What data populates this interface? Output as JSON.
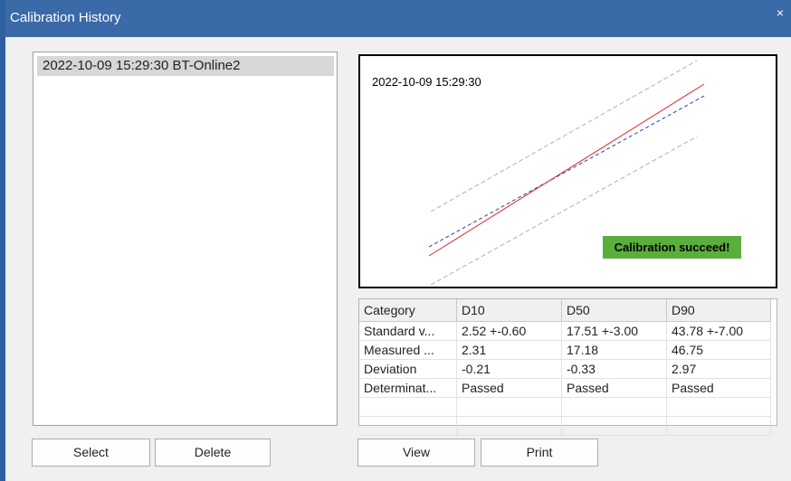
{
  "window": {
    "title": "Calibration History",
    "close_glyph": "×"
  },
  "history_list": {
    "items": [
      "2022-10-09 15:29:30 BT-Online2"
    ]
  },
  "chart": {
    "timestamp": "2022-10-09 15:29:30",
    "status_text": "Calibration succeed!",
    "status_color": "#5aaf3c",
    "measured_line_color": "#e8262b",
    "reference_line_color": "#2243b6",
    "tolerance_line_color": "#b0b0b0"
  },
  "table": {
    "headers": [
      "Category",
      "D10",
      "D50",
      "D90"
    ],
    "rows": [
      [
        "Standard v...",
        "2.52 +-0.60",
        "17.51 +-3.00",
        "43.78 +-7.00"
      ],
      [
        "Measured ...",
        "2.31",
        "17.18",
        "46.75"
      ],
      [
        "Deviation",
        "-0.21",
        "-0.33",
        "2.97"
      ],
      [
        "Determinat...",
        "Passed",
        "Passed",
        "Passed"
      ]
    ]
  },
  "buttons": {
    "select": "Select",
    "delete": "Delete",
    "view": "View",
    "print": "Print"
  }
}
